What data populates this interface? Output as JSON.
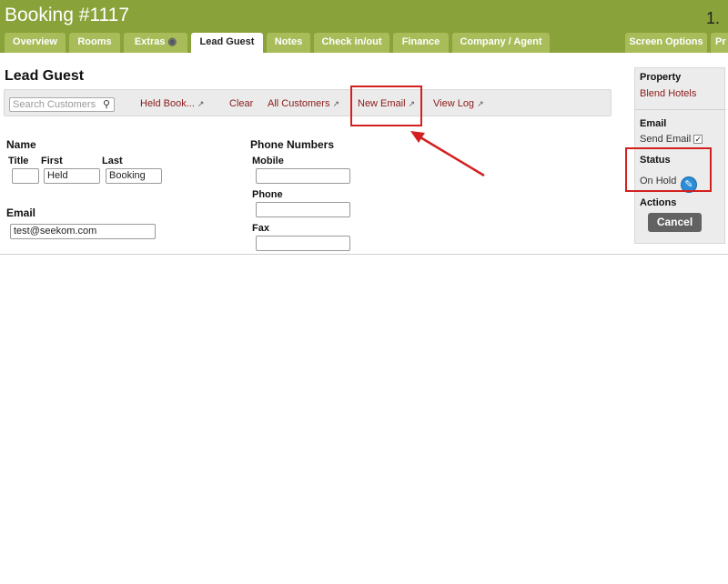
{
  "header": {
    "title": "Booking #1117",
    "page_number": "1."
  },
  "tabs": [
    {
      "label": "Overview"
    },
    {
      "label": "Rooms"
    },
    {
      "label": "Extras"
    },
    {
      "label": "Lead Guest",
      "active": true
    },
    {
      "label": "Notes"
    },
    {
      "label": "Check in/out"
    },
    {
      "label": "Finance"
    },
    {
      "label": "Company / Agent"
    },
    {
      "label": "Screen Options"
    },
    {
      "label": "Pr"
    }
  ],
  "main": {
    "heading": "Lead Guest",
    "search": {
      "placeholder": "Search Customers",
      "value": ""
    },
    "toolbar_links": {
      "held_booking": "Held Book...",
      "clear": "Clear",
      "all_customers": "All Customers",
      "new_email": "New Email",
      "view_log": "View Log"
    },
    "name": {
      "label": "Name",
      "title_label": "Title",
      "first_label": "First",
      "last_label": "Last",
      "title_value": "",
      "first_value": "Held",
      "last_value": "Booking"
    },
    "email": {
      "label": "Email",
      "value": "test@seekom.com"
    },
    "phone": {
      "label": "Phone Numbers",
      "mobile_label": "Mobile",
      "mobile_value": "",
      "phone_label": "Phone",
      "phone_value": "",
      "fax_label": "Fax",
      "fax_value": ""
    }
  },
  "side": {
    "property_label": "Property",
    "property_value": "Blend Hotels",
    "email_label": "Email",
    "send_email_label": "Send Email",
    "send_email_checked": true,
    "status_label": "Status",
    "status_value": "On Hold",
    "actions_label": "Actions",
    "cancel_label": "Cancel"
  },
  "colors": {
    "header_bg": "#8aa23a",
    "tab_bg": "#a8bc5a",
    "link": "#8b1a1a",
    "highlight": "#d3201f",
    "edit_icon": "#2a8ed8"
  }
}
